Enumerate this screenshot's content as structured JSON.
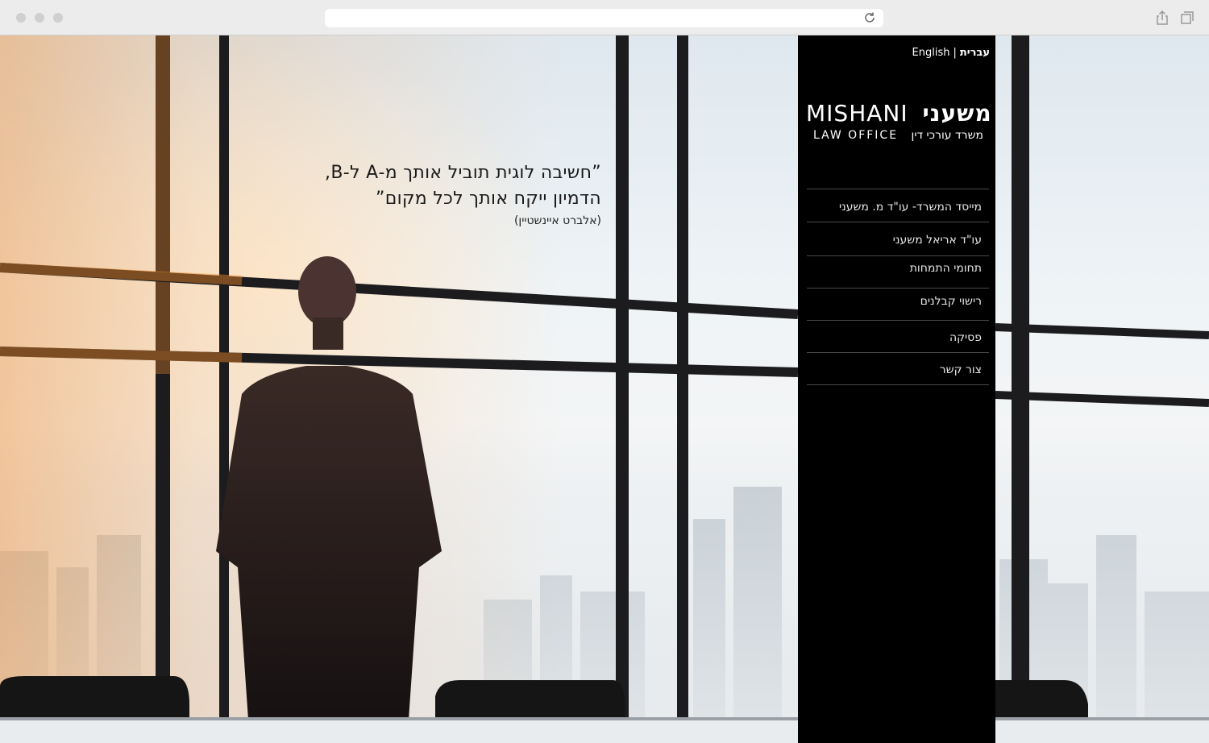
{
  "browser": {
    "url": "",
    "icons": {
      "reload": "reload-icon",
      "share": "share-icon",
      "tabs": "tabs-icon"
    }
  },
  "quote": {
    "line1": "”חשיבה לוגית תוביל אותך מ-A ל-B,",
    "line2": "הדמיון ייקח אותך לכל מקום”",
    "author": "(אלברט איינשטיין)"
  },
  "sidebar": {
    "lang_english": "English",
    "lang_separator": "|",
    "lang_hebrew": "עברית",
    "logo_name_he": "משעני",
    "logo_name_en": "MISHANI",
    "logo_sub_he": "משרד עורכי דין",
    "logo_sub_en": "LAW OFFICE",
    "nav": [
      {
        "label": "מייסד המשרד- עו\"ד מ. משעני"
      },
      {
        "label": "עו\"ד אריאל משעני"
      },
      {
        "label": "תחומי התמחות"
      },
      {
        "label": "רישוי קבלנים"
      },
      {
        "label": "פסיקה"
      },
      {
        "label": "צור קשר"
      }
    ]
  },
  "colors": {
    "sidebar_bg": "#000000",
    "sidebar_text": "#ffffff",
    "divider": "#4a4a4a",
    "window_frame": "#1a1a1a",
    "sunlight": "#f08a2a"
  }
}
